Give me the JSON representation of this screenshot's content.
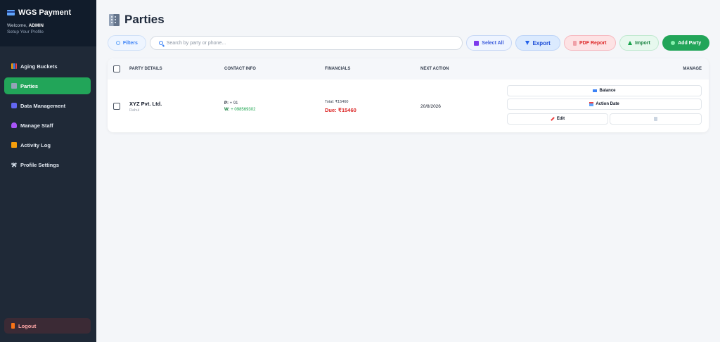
{
  "sidebar": {
    "brand": "WGS Payment",
    "welcome_prefix": "Welcome,",
    "welcome_user": "ADMIN",
    "setup_link": "Setup Your Profile",
    "items": [
      {
        "label": "Aging Buckets"
      },
      {
        "label": "Parties"
      },
      {
        "label": "Data Management"
      },
      {
        "label": "Manage Staff"
      },
      {
        "label": "Activity Log"
      },
      {
        "label": "Profile Settings"
      }
    ],
    "logout": "Logout"
  },
  "page": {
    "title": "Parties"
  },
  "toolbar": {
    "filters": "Filters",
    "search_placeholder": "Search by party or phone...",
    "select_all": "Select All",
    "export": "Export",
    "pdf_report": "PDF Report",
    "import": "Import",
    "add_party": "Add Party"
  },
  "table": {
    "headers": {
      "party": "PARTY DETAILS",
      "contact": "CONTACT INFO",
      "financials": "FINANCIALS",
      "next_action": "NEXT ACTION",
      "manage": "MANAGE"
    },
    "rows": [
      {
        "name": "XYZ Pvt. Ltd.",
        "contact_person": "Rahul",
        "phone_label": "P:",
        "phone": "+ 91",
        "whatsapp_label": "W:",
        "whatsapp": "+ 098569302",
        "total": "Total: ₹15460",
        "due": "Due: ₹15460",
        "next_action": "20/8/2026"
      }
    ],
    "manage_buttons": {
      "balance": "Balance",
      "action_date": "Action Date",
      "edit": "Edit"
    }
  },
  "colors": {
    "sidebar_bg": "#1f2937",
    "accent_green": "#22a559",
    "due_red": "#dc2626"
  }
}
